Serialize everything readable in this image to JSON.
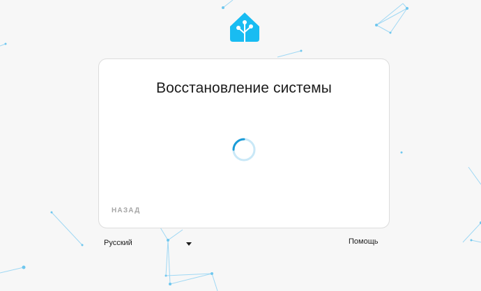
{
  "card": {
    "title": "Восстановление системы",
    "back_label": "НАЗАД"
  },
  "footer": {
    "language_selected": "Русский",
    "help_label": "Помощь"
  },
  "colors": {
    "brand": "#18bcf2",
    "spinner": "#1a9bd7",
    "spinner_track": "#c9e8f7",
    "background": "#f7f7f7",
    "card": "#ffffff",
    "muted": "#a6a6a6"
  },
  "icons": {
    "logo": "home-assistant-logo-icon",
    "dropdown": "chevron-down-icon"
  }
}
